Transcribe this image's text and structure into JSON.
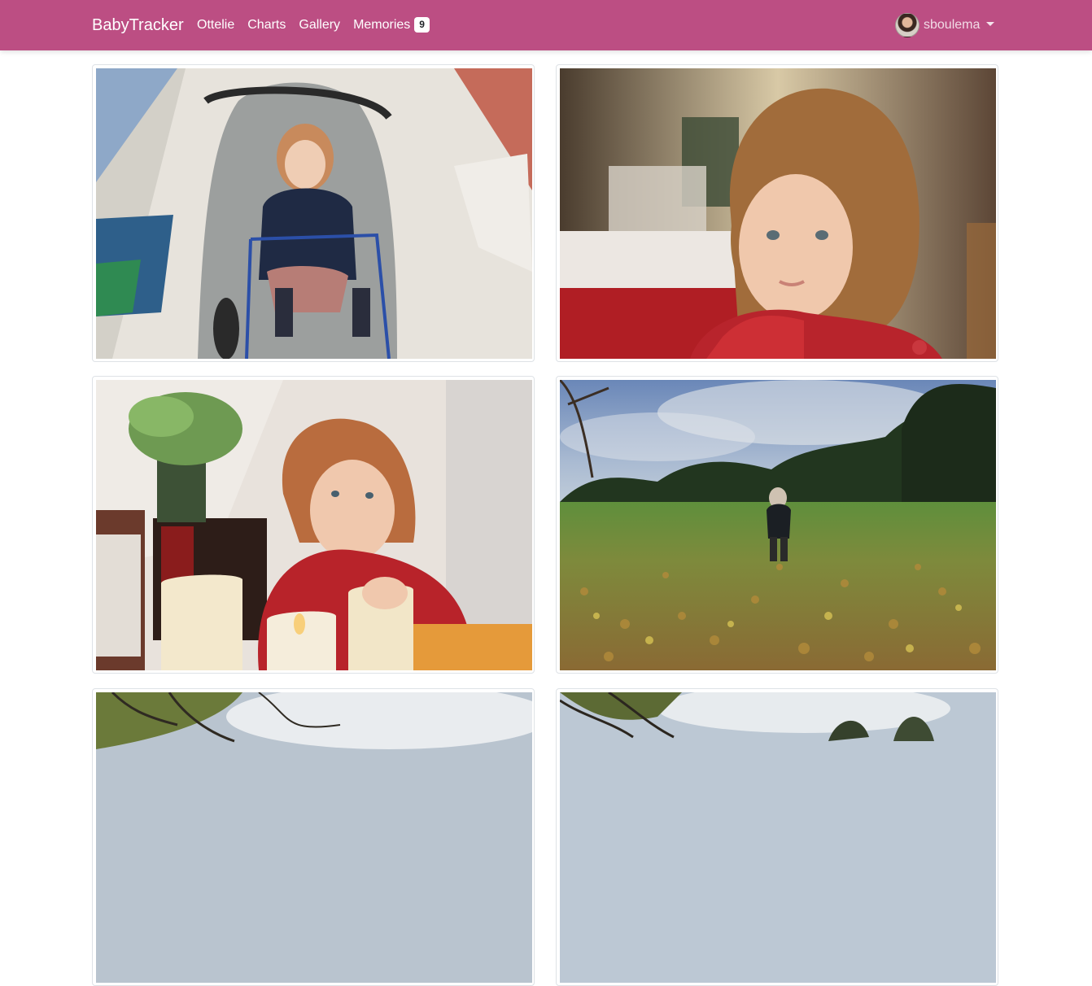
{
  "navbar": {
    "brand": "BabyTracker",
    "links": [
      {
        "label": "Ottelie"
      },
      {
        "label": "Charts"
      },
      {
        "label": "Gallery"
      },
      {
        "label": "Memories",
        "badge": "9"
      }
    ],
    "user": {
      "name": "sboulema"
    },
    "color": "#bc4e83"
  },
  "gallery": {
    "photos": [
      {
        "subject": "toddler-in-stroller-supermarket"
      },
      {
        "subject": "toddler-red-cardigan-closeup"
      },
      {
        "subject": "toddler-with-led-candles"
      },
      {
        "subject": "toddler-walking-in-autumn-leaves"
      },
      {
        "subject": "trees-and-sky"
      },
      {
        "subject": "trees-and-sky"
      }
    ]
  }
}
